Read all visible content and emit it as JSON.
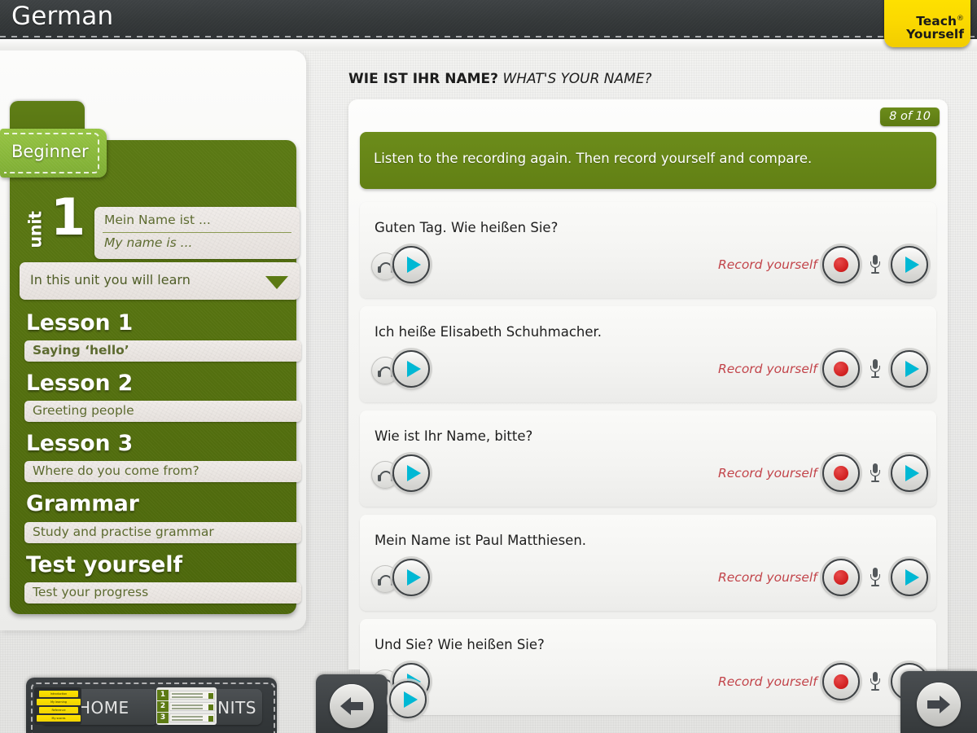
{
  "header": {
    "course_title": "German",
    "brand_line1": "Teach",
    "brand_line2": "Yourself",
    "brand_registered": "®"
  },
  "sidebar": {
    "level_label": "Beginner",
    "unit": {
      "word": "unit",
      "number": "1",
      "phrase_de": "Mein Name ist ...",
      "phrase_en": "My name is ...",
      "learn_dropdown_label": "In this unit you will learn"
    },
    "lessons": [
      {
        "heading": "Lesson 1",
        "subtitle": "Saying ‘hello’",
        "active": true
      },
      {
        "heading": "Lesson 2",
        "subtitle": "Greeting people",
        "active": false
      },
      {
        "heading": "Lesson 3",
        "subtitle": "Where do you come from?",
        "active": false
      },
      {
        "heading": "Grammar",
        "subtitle": "Study and practise grammar",
        "active": false
      },
      {
        "heading": "Test yourself",
        "subtitle": "Test your progress",
        "active": false
      }
    ]
  },
  "main": {
    "exercise_title_de": "WIE IST IHR NAME?",
    "exercise_title_en": "WHAT'S YOUR NAME?",
    "progress_badge": "8 of 10",
    "instruction": "Listen to the recording again. Then record yourself and compare.",
    "record_label": "Record yourself",
    "exercises": [
      {
        "sentence": "Guten Tag. Wie heißen Sie?"
      },
      {
        "sentence": "Ich heiße Elisabeth Schuhmacher."
      },
      {
        "sentence": "Wie ist Ihr Name, bitte?"
      },
      {
        "sentence": "Mein Name ist Paul Matthiesen."
      },
      {
        "sentence": "Und Sie? Wie heißen Sie?"
      }
    ]
  },
  "bottom": {
    "home_label": "HOME",
    "units_label": "UNITS",
    "home_thumb_tabs": [
      "Introduction",
      "My learning",
      "Reference",
      "My scores"
    ],
    "units_thumb_rows": [
      "1",
      "2",
      "3"
    ]
  },
  "colors": {
    "brand_yellow": "#ffe400",
    "unit_green": "#5c7a14",
    "level_green": "#8ebb3d",
    "instruction_green": "#6c8c1b",
    "record_red": "#c2444a",
    "play_cyan": "#00b8d4",
    "header_dark": "#343839"
  }
}
